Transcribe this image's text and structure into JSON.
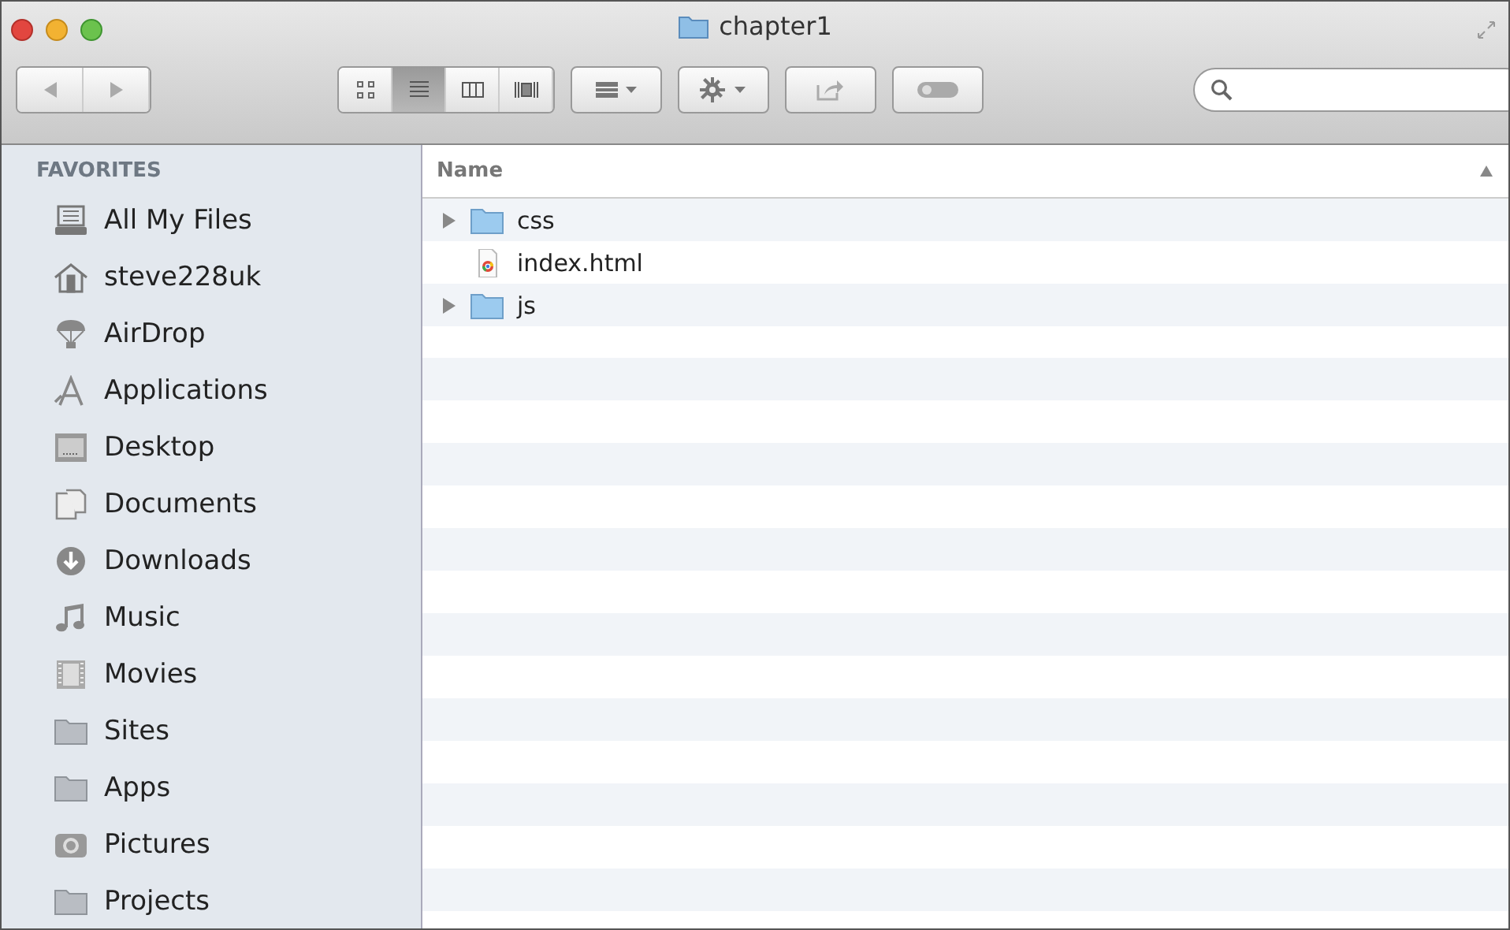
{
  "window": {
    "title": "chapter1"
  },
  "view_modes": [
    {
      "selected": false
    },
    {
      "selected": true
    },
    {
      "selected": false
    },
    {
      "selected": false
    }
  ],
  "sidebar": {
    "heading": "FAVORITES",
    "items": [
      {
        "label": "All My Files"
      },
      {
        "label": "steve228uk"
      },
      {
        "label": "AirDrop"
      },
      {
        "label": "Applications"
      },
      {
        "label": "Desktop"
      },
      {
        "label": "Documents"
      },
      {
        "label": "Downloads"
      },
      {
        "label": "Music"
      },
      {
        "label": "Movies"
      },
      {
        "label": "Sites"
      },
      {
        "label": "Apps"
      },
      {
        "label": "Pictures"
      },
      {
        "label": "Projects"
      }
    ]
  },
  "table": {
    "columns": [
      {
        "label": "Name"
      }
    ],
    "rows": [
      {
        "name": "css",
        "kind": "folder",
        "expanded": false
      },
      {
        "name": "index.html",
        "kind": "file"
      },
      {
        "name": "js",
        "kind": "folder",
        "expanded": false
      }
    ]
  }
}
